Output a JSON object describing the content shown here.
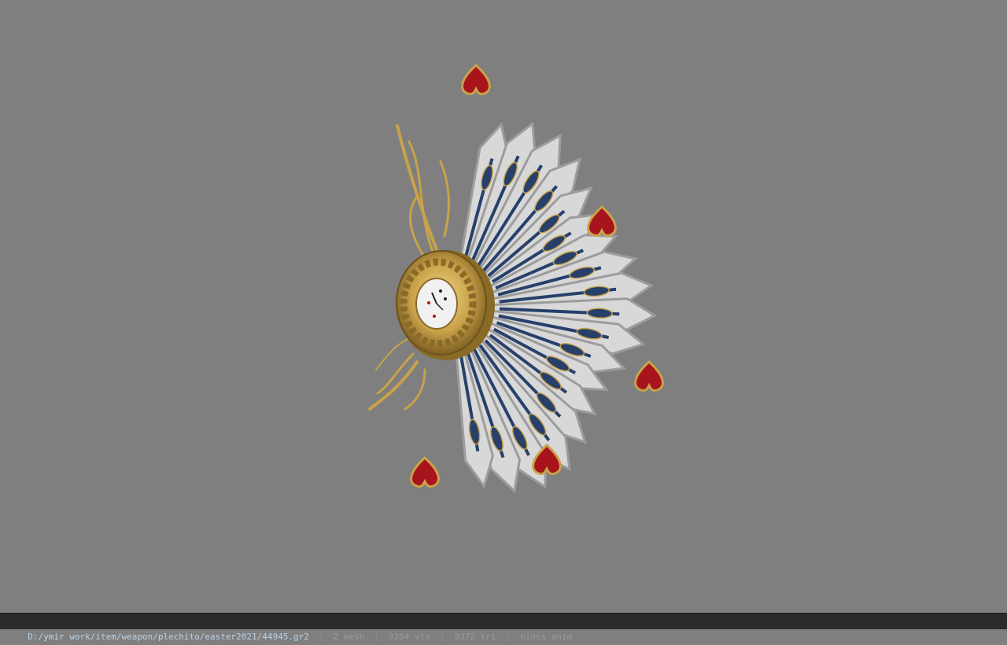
{
  "viewport": {
    "background_color": "#7f7f7f",
    "model": {
      "description_icon": "playing-card-fan-clock-icon",
      "colors": {
        "blade": "#d8d8d8",
        "blade_edge": "#9c9c9c",
        "stripe": "#27406b",
        "gold": "#c9a24a",
        "spade": "#a8141b"
      }
    }
  },
  "statusbar": {
    "path": "D:/ymir work/item/weapon/plechito/easter2021/44945.gr2",
    "sep": "|",
    "mesh": "2 mesh",
    "vtx": "9264 vtx",
    "tri": "8372 tri",
    "anim": "nincs anim"
  }
}
